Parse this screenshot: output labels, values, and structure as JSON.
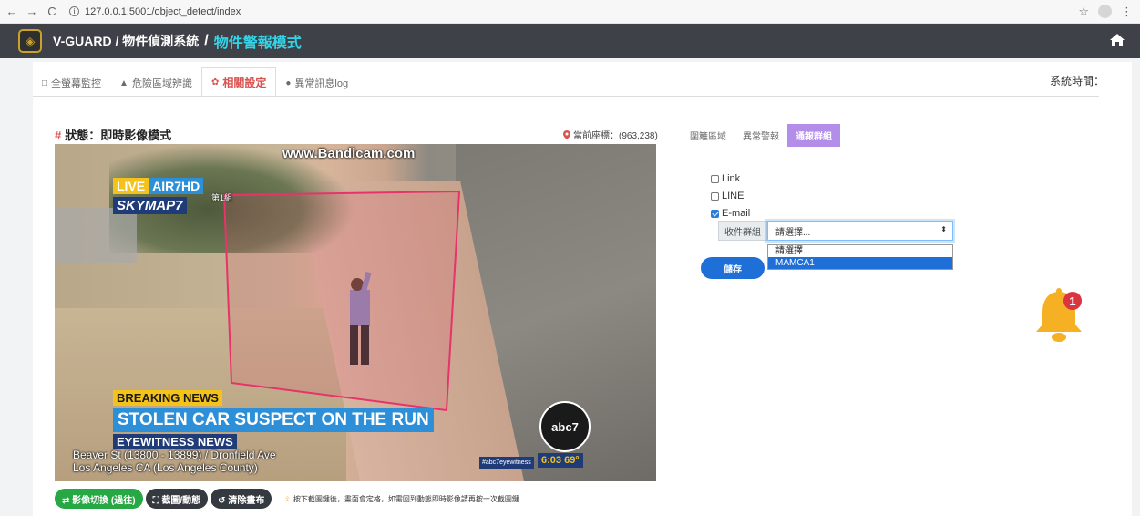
{
  "browser": {
    "back": "←",
    "forward": "→",
    "reload": "C",
    "url": "127.0.0.1:5001/object_detect/index",
    "star": "☆",
    "menu": "⋮"
  },
  "header": {
    "brand": "V-GUARD / 物件偵測系統",
    "separator": "/",
    "mode": "物件警報模式"
  },
  "tabs": [
    {
      "icon": "□",
      "label": "全螢幕監控"
    },
    {
      "icon": "▲",
      "label": "危險區域辨識"
    },
    {
      "icon": "✿",
      "label": "相關設定"
    },
    {
      "icon": "●",
      "label": "異常訊息log"
    }
  ],
  "system_time_label": "系統時間：",
  "status": {
    "hash": "#",
    "title": "狀態：即時影像模式",
    "coord": "當前座標：(963,238)"
  },
  "video": {
    "watermark": "www.Bandicam.com",
    "live": "LIVE",
    "air": "AIR7HD",
    "skymap": "SKYMAP7",
    "zone_label": "第1組",
    "breaking": "BREAKING NEWS",
    "headline": "STOLEN CAR SUSPECT ON THE RUN",
    "eyewitness": "EYEWITNESS NEWS",
    "address_line1": "Beaver St (13800 - 13899) / Dronfield Ave",
    "address_line2": "Los Angeles CA (Los Angeles County)",
    "abc": "abc7",
    "hashtag": "#abc7eyewitness",
    "clock": "6:03  69°"
  },
  "controls": {
    "switch": "⇄ 影像切換 (過往)",
    "capture": "⛶ 截圖/動態",
    "clear": "↺ 清除畫布",
    "hint": "按下截圖鍵後，畫面會定格，如需回到動態即時影像請再按一次截圖鍵"
  },
  "subtabs": [
    "圍籬區域",
    "異常警報",
    "通報群組"
  ],
  "options": [
    {
      "label": "Link",
      "checked": false
    },
    {
      "label": "LINE",
      "checked": false
    },
    {
      "label": "E-mail",
      "checked": true
    }
  ],
  "group": {
    "label": "收件群組",
    "selected": "請選擇...",
    "options": [
      "請選擇...",
      "MAMCA1"
    ]
  },
  "save_label": "儲存",
  "notification_count": "1"
}
